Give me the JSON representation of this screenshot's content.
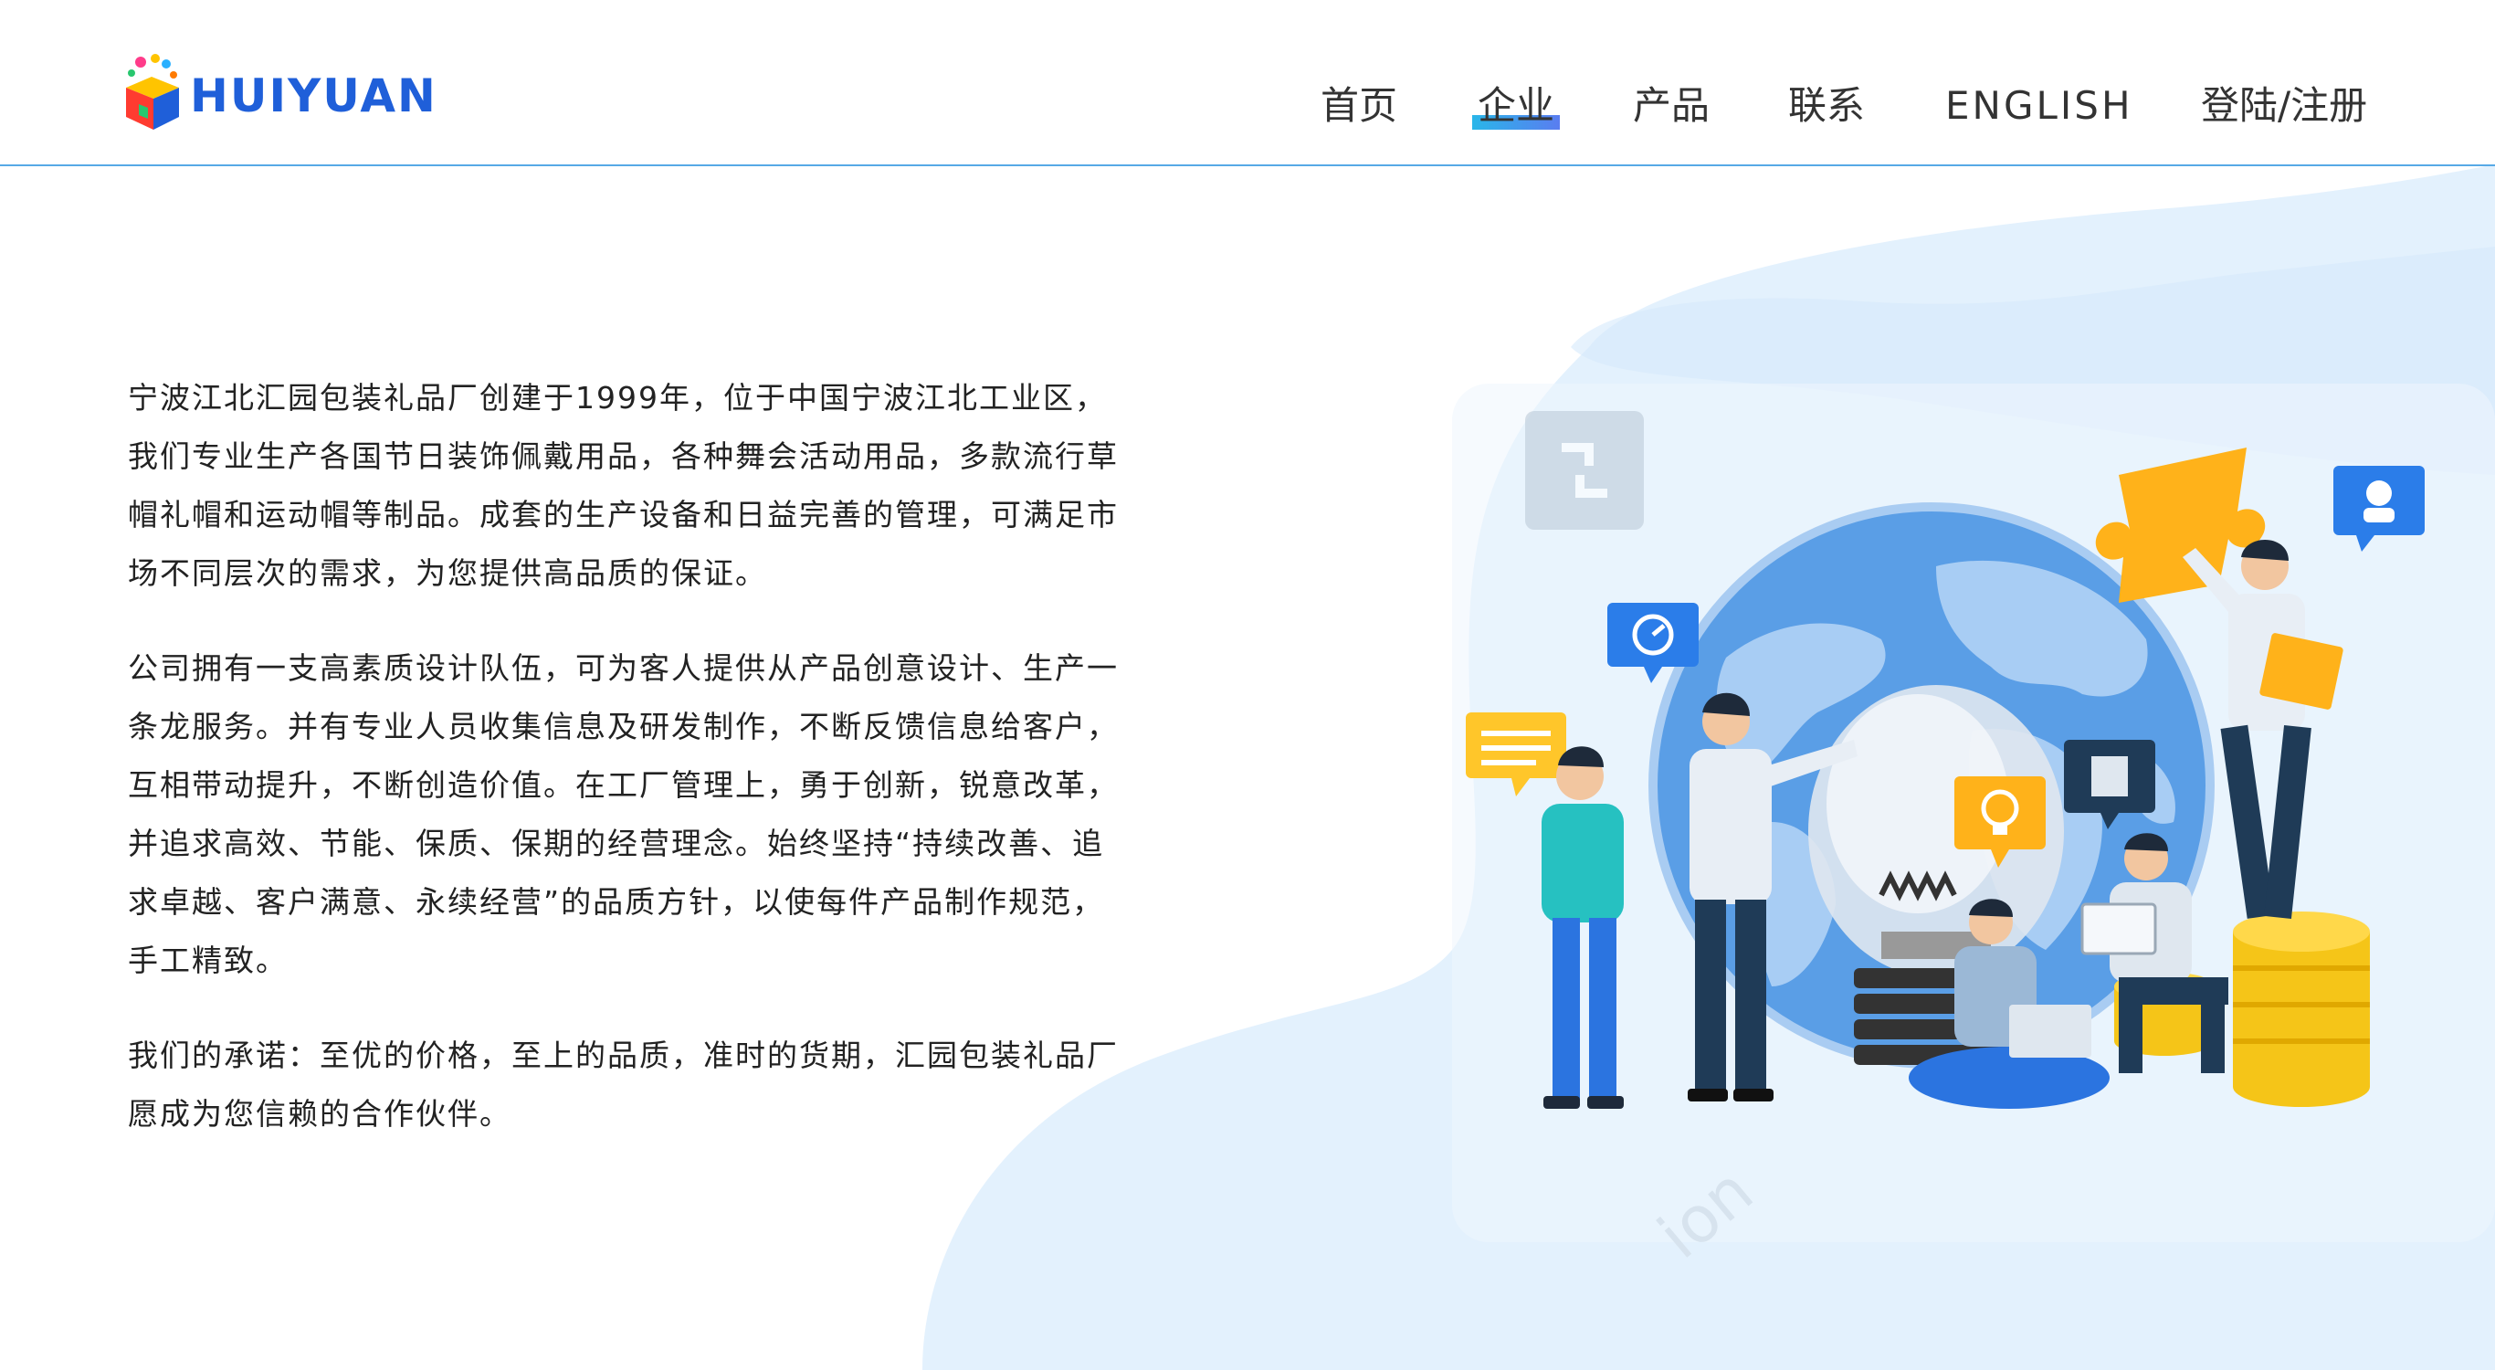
{
  "brand": {
    "logo_text": "HUIYUAN"
  },
  "nav": {
    "items": [
      {
        "label": "首页",
        "active": false
      },
      {
        "label": "企业",
        "active": true
      },
      {
        "label": "产品",
        "active": false
      },
      {
        "label": "联系",
        "active": false
      },
      {
        "label": "ENGLISH",
        "active": false
      },
      {
        "label": "登陆/注册",
        "active": false
      }
    ]
  },
  "content": {
    "paragraphs": [
      "宁波江北汇园包装礼品厂创建于1999年，位于中国宁波江北工业区，我们专业生产各国节日装饰佩戴用品，各种舞会活动用品，多款流行草帽礼帽和运动帽等制品。成套的生产设备和日益完善的管理，可满足市场不同层次的需求，为您提供高品质的保证。",
      "公司拥有一支高素质设计队伍，可为客人提供从产品创意设计、生产一条龙服务。并有专业人员收集信息及研发制作，不断反馈信息给客户，互相带动提升，不断创造价值。在工厂管理上，勇于创新，锐意改革，并追求高效、节能、保质、保期的经营理念。始终坚持“持续改善、追求卓越、客户满意、永续经营”的品质方针，以使每件产品制作规范，手工精致。",
      "我们的承诺：至优的价格，至上的品质，准时的货期，汇园包装礼品厂愿成为您信赖的合作伙伴。"
    ]
  },
  "illustration": {
    "watermark_text": "ion"
  },
  "colors": {
    "header_border": "#57a9e6",
    "nav_active_from": "#29b6e9",
    "nav_active_to": "#5a7df0",
    "logo_text": "#1f5fd9",
    "blob": "#e3f1fd"
  }
}
